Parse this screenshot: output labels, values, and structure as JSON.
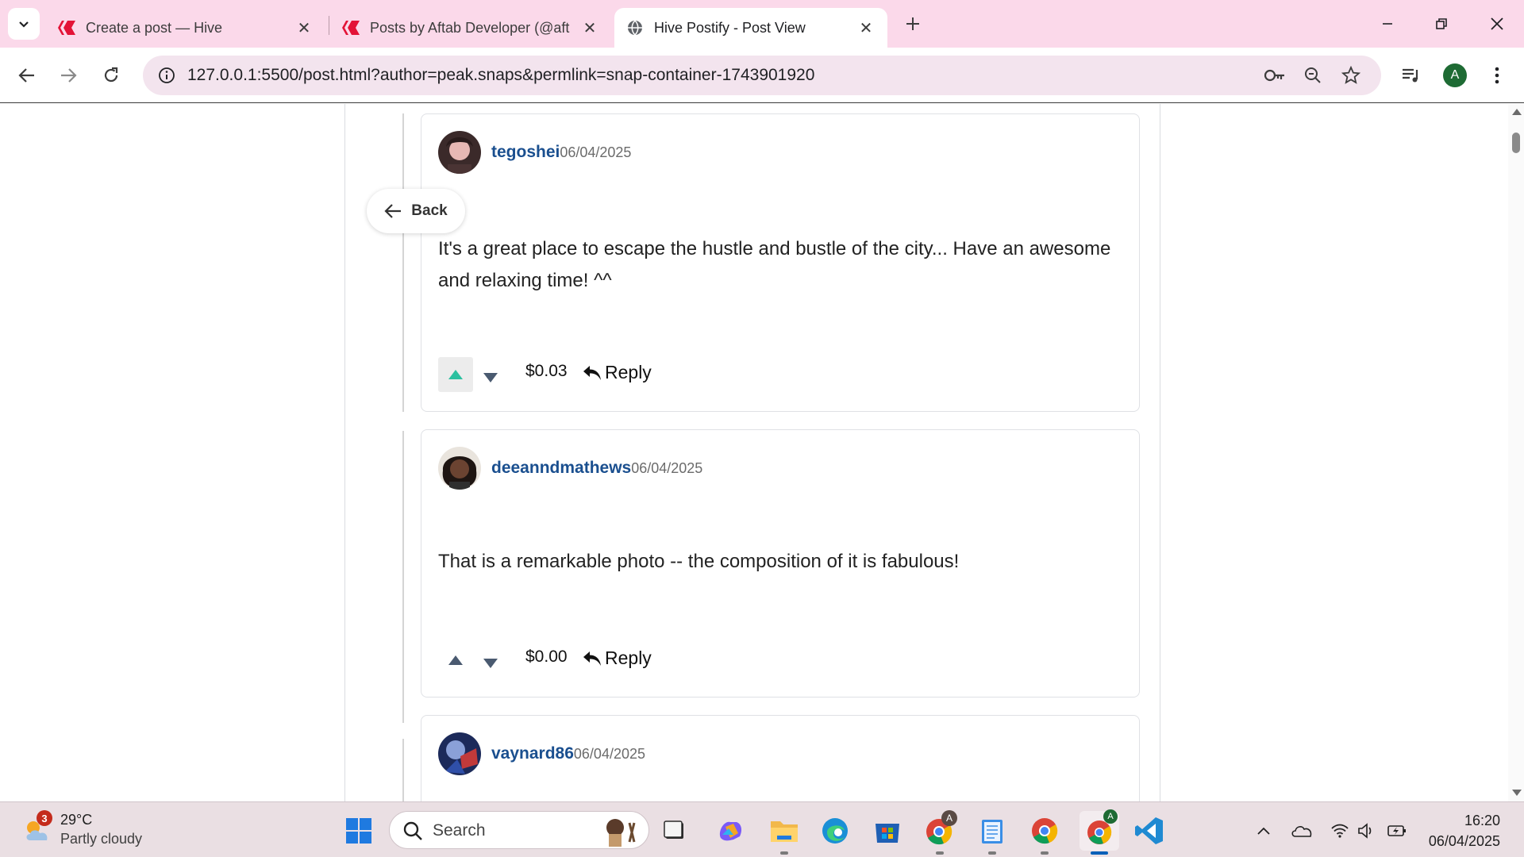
{
  "browser": {
    "tabs": [
      {
        "title": "Create a post — Hive",
        "favicon": "hive-logo-icon",
        "active": false
      },
      {
        "title": "Posts by Aftab Developer (@aft",
        "favicon": "hive-logo-icon",
        "active": false
      },
      {
        "title": "Hive Postify - Post View",
        "favicon": "globe-icon",
        "active": true
      }
    ],
    "url": "127.0.0.1:5500/post.html?author=peak.snaps&permlink=snap-container-1743901920",
    "profile_initial": "A"
  },
  "page": {
    "back_label": "Back",
    "comments": [
      {
        "author": "tegoshei",
        "date": "06/04/2025",
        "body": "It's a great place to escape the hustle and bustle of the city... Have an awesome and relaxing time! ^^",
        "payout": "$0.03",
        "reply_label": "Reply",
        "upvoted": true
      },
      {
        "author": "deeanndmathews",
        "date": "06/04/2025",
        "body": "That is a remarkable photo -- the composition of it is fabulous!",
        "payout": "$0.00",
        "reply_label": "Reply",
        "upvoted": false
      },
      {
        "author": "vaynard86",
        "date": "06/04/2025"
      }
    ]
  },
  "taskbar": {
    "weather_badge": "3",
    "temperature": "29°C",
    "condition": "Partly cloudy",
    "search_placeholder": "Search",
    "chrome_profile_badge": "A",
    "time": "16:20",
    "date": "06/04/2025"
  },
  "colors": {
    "tabstrip_bg": "#fbd9ea",
    "omnibox_bg": "#f3e4ee",
    "author_link": "#1a4f8f",
    "upvote_active": "#2bc0a0",
    "taskbar_bg": "#eadfe3"
  }
}
